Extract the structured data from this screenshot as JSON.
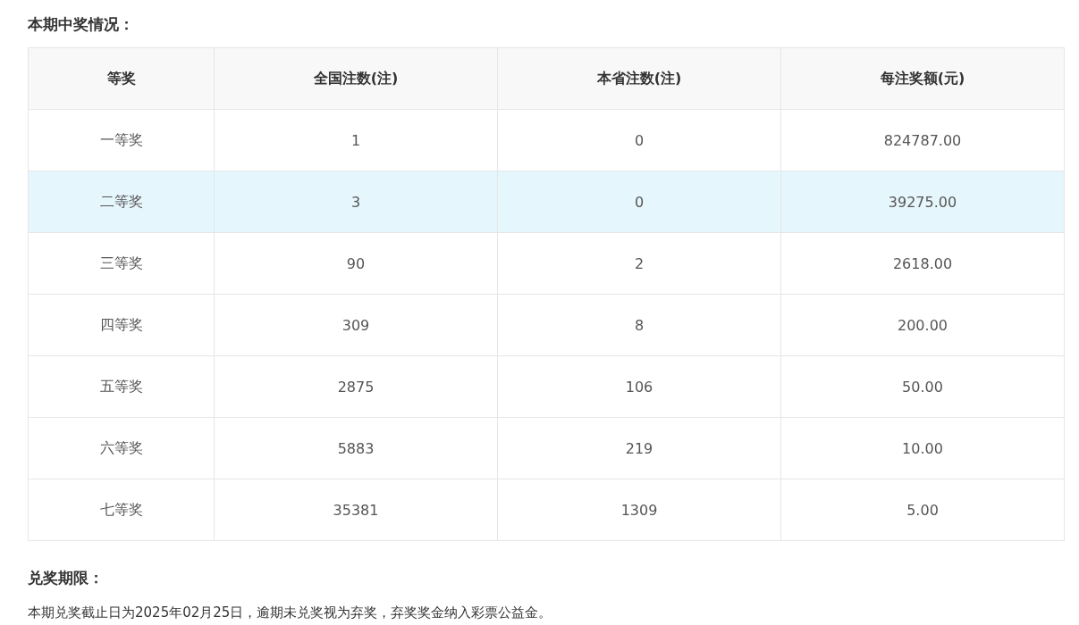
{
  "prize_section": {
    "heading": "本期中奖情况：",
    "table": {
      "columns": [
        "等奖",
        "全国注数(注)",
        "本省注数(注)",
        "每注奖额(元)"
      ],
      "rows": [
        {
          "cells": [
            "一等奖",
            "1",
            "0",
            "824787.00"
          ],
          "highlighted": false
        },
        {
          "cells": [
            "二等奖",
            "3",
            "0",
            "39275.00"
          ],
          "highlighted": true
        },
        {
          "cells": [
            "三等奖",
            "90",
            "2",
            "2618.00"
          ],
          "highlighted": false
        },
        {
          "cells": [
            "四等奖",
            "309",
            "8",
            "200.00"
          ],
          "highlighted": false
        },
        {
          "cells": [
            "五等奖",
            "2875",
            "106",
            "50.00"
          ],
          "highlighted": false
        },
        {
          "cells": [
            "六等奖",
            "5883",
            "219",
            "10.00"
          ],
          "highlighted": false
        },
        {
          "cells": [
            "七等奖",
            "35381",
            "1309",
            "5.00"
          ],
          "highlighted": false
        }
      ]
    }
  },
  "deadline_section": {
    "heading": "兑奖期限：",
    "text": "本期兑奖截止日为2025年02月25日，逾期未兑奖视为弃奖，弃奖奖金纳入彩票公益金。"
  }
}
